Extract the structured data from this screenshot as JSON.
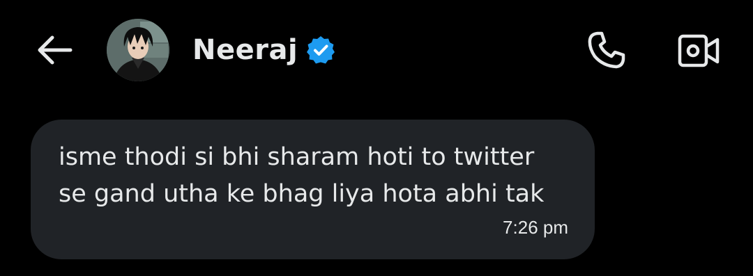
{
  "header": {
    "contact_name": "Neeraj",
    "back_icon": "arrow-left-icon",
    "verified_icon": "verified-badge-icon",
    "call_icon": "phone-icon",
    "video_icon": "video-camera-icon",
    "avatar": "anime-boy-avatar"
  },
  "colors": {
    "background": "#000000",
    "bubble": "#202327",
    "text": "#e7e9ea",
    "verified": "#1d9bf0"
  },
  "messages": [
    {
      "text": "isme thodi si bhi sharam hoti to twitter\nse gand utha ke bhag liya hota abhi tak",
      "time": "7:26 pm"
    }
  ]
}
